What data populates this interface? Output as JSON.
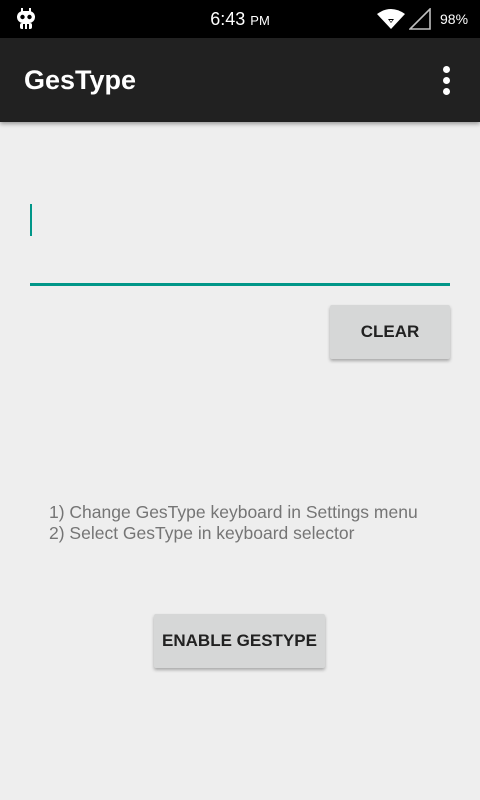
{
  "status_bar": {
    "time": "6:43",
    "ampm": "PM",
    "battery": "98%"
  },
  "app_bar": {
    "title": "GesType"
  },
  "input": {
    "value": ""
  },
  "buttons": {
    "clear": "CLEAR",
    "enable": "ENABLE GESTYPE"
  },
  "instructions": {
    "line1": "1) Change GesType keyboard in Settings menu",
    "line2": "2) Select GesType in keyboard selector"
  },
  "colors": {
    "accent": "#009688",
    "app_bar": "#212121",
    "status_bar": "#000000",
    "background": "#eeeeee",
    "button": "#d6d7d7"
  },
  "icons": {
    "status_left": "cyanogen-robot-icon",
    "wifi": "wifi-icon",
    "signal": "cell-signal-icon",
    "overflow": "more-vert-icon"
  }
}
